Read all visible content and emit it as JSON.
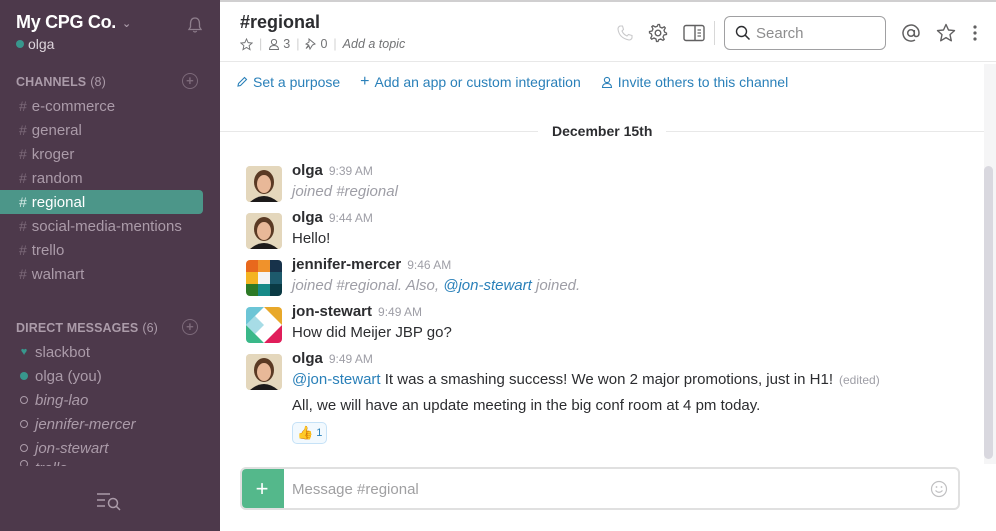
{
  "sidebar": {
    "team_name": "My CPG Co.",
    "current_user": "olga",
    "channels_header": "CHANNELS",
    "channels_count": "(8)",
    "channels": [
      {
        "name": "e-commerce",
        "active": false
      },
      {
        "name": "general",
        "active": false
      },
      {
        "name": "kroger",
        "active": false
      },
      {
        "name": "random",
        "active": false
      },
      {
        "name": "regional",
        "active": true
      },
      {
        "name": "social-media-mentions",
        "active": false
      },
      {
        "name": "trello",
        "active": false
      },
      {
        "name": "walmart",
        "active": false
      }
    ],
    "dm_header": "DIRECT MESSAGES",
    "dm_count": "(6)",
    "direct_messages": [
      {
        "name": "slackbot",
        "status": "bot"
      },
      {
        "name": "olga (you)",
        "status": "online"
      },
      {
        "name": "bing-lao",
        "status": "away"
      },
      {
        "name": "jennifer-mercer",
        "status": "away"
      },
      {
        "name": "jon-stewart",
        "status": "away"
      },
      {
        "name": "trello",
        "status": "away"
      }
    ]
  },
  "header": {
    "channel_title": "#regional",
    "member_count": "3",
    "pinned_count": "0",
    "topic_placeholder": "Add a topic",
    "search_placeholder": "Search"
  },
  "intro": {
    "set_purpose": "Set a purpose",
    "add_integration": "Add an app or custom integration",
    "invite_others": "Invite others to this channel"
  },
  "day_divider": "December 15th",
  "messages": [
    {
      "sender": "olga",
      "time": "9:39 AM",
      "text": "joined #regional",
      "system": true
    },
    {
      "sender": "olga",
      "time": "9:44 AM",
      "text": "Hello!",
      "system": false
    },
    {
      "sender": "jennifer-mercer",
      "time": "9:46 AM",
      "text_before": "joined #regional. Also, ",
      "mention": "@jon-stewart",
      "text_after": " joined.",
      "system": true
    },
    {
      "sender": "jon-stewart",
      "time": "9:49 AM",
      "text": "How did Meijer JBP go?",
      "system": false
    },
    {
      "sender": "olga",
      "time": "9:49 AM",
      "mention": "@jon-stewart",
      "text_after": " It was a smashing success! We won 2 major promotions, just in H1!",
      "edited": "(edited)",
      "second_line": "All, we will have an update meeting in the big conf room at 4 pm today.",
      "reaction": {
        "emoji": "👍",
        "count": "1"
      }
    }
  ],
  "composer": {
    "placeholder": "Message #regional",
    "value": ""
  },
  "colors": {
    "sidebar_bg": "#4d394b",
    "active_channel": "#4c9689",
    "presence": "#38978d",
    "link": "#2a80b9",
    "composer_plus": "#54b88b"
  }
}
